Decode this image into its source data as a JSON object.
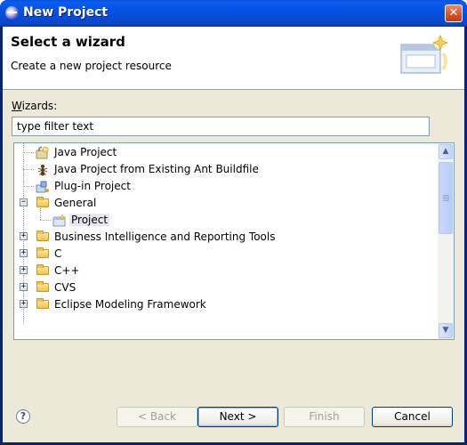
{
  "window": {
    "title": "New Project",
    "close_label": "✕"
  },
  "header": {
    "title": "Select a wizard",
    "description": "Create a new project resource"
  },
  "wizards_label_prefix": "W",
  "wizards_label_rest": "izards:",
  "filter": {
    "value": "type filter text"
  },
  "tree": {
    "items": [
      {
        "label": "Java Project",
        "icon": "java-project-icon"
      },
      {
        "label": "Java Project from Existing Ant Buildfile",
        "icon": "ant-icon"
      },
      {
        "label": "Plug-in Project",
        "icon": "plugin-project-icon"
      },
      {
        "label": "General",
        "icon": "folder-open-icon",
        "expanded": true
      },
      {
        "label": "Project",
        "icon": "project-icon",
        "selected": true
      },
      {
        "label": "Business Intelligence and Reporting Tools",
        "icon": "folder-icon"
      },
      {
        "label": "C",
        "icon": "folder-icon"
      },
      {
        "label": "C++",
        "icon": "folder-icon"
      },
      {
        "label": "CVS",
        "icon": "folder-icon"
      },
      {
        "label": "Eclipse Modeling Framework",
        "icon": "folder-icon"
      }
    ]
  },
  "buttons": {
    "help": "?",
    "back": "< Back",
    "next": "Next >",
    "finish": "Finish",
    "cancel": "Cancel"
  }
}
